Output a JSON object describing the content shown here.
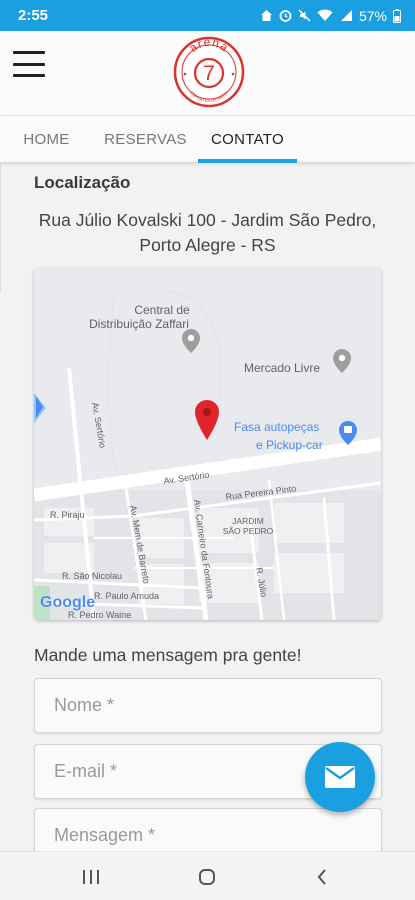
{
  "status_bar": {
    "time": "2:55",
    "battery": "57%",
    "icons": [
      "home-icon",
      "alarm-icon",
      "mute-icon",
      "wifi-icon",
      "signal-icon",
      "battery-icon"
    ]
  },
  "header": {
    "menu_icon": "hamburger-menu-icon",
    "logo": {
      "top_text": "arena",
      "number": "7",
      "bottom_text": "ESPORTES DE AREIA"
    }
  },
  "tabs": [
    {
      "label": "HOME",
      "active": false
    },
    {
      "label": "RESERVAS",
      "active": false
    },
    {
      "label": "CONTATO",
      "active": true
    }
  ],
  "location": {
    "title": "Localização",
    "address": "Rua Júlio Kovalski 100 - Jardim São Pedro, Porto Alegre - RS"
  },
  "map": {
    "labels": {
      "poi_zaffari_1": "Central de",
      "poi_zaffari_2": "Distribuição Zaffari",
      "poi_mercado": "Mercado Livre",
      "poi_fasa_1": "Fasa autopeças",
      "poi_fasa_2": "e Pickup-car",
      "street_sertorio_h": "Av. Sertório",
      "street_sertorio_v": "Av. Sertório",
      "street_pereira": "Rua Pereira Pinto",
      "district_1": "JARDIM",
      "district_2": "SÃO PEDRO",
      "street_piraju": "R. Piraju",
      "street_mem": "Av. Mem de Barreto",
      "street_carneiro": "Av. Carneiro da Fontoura",
      "street_nicolau": "R. São Nicolau",
      "street_amuda": "R. Paulo Amuda",
      "street_pedro": "R. Pedro Waine",
      "street_julio": "R. Júlio",
      "google": "Google"
    },
    "colors": {
      "water": "#8ec9ec",
      "poi": "#9e9e9e",
      "shopping": "#4a8af4",
      "pin": "#e0252b"
    }
  },
  "contact_form": {
    "title": "Mande uma mensagem pra gente!",
    "name_placeholder": "Nome *",
    "email_placeholder": "E-mail *",
    "message_placeholder": "Mensagem *",
    "fab_icon": "envelope-icon"
  },
  "nav": {
    "recents_icon": "recents-icon",
    "home_icon": "home-circle-icon",
    "back_icon": "back-chevron-icon"
  },
  "colors": {
    "primary": "#1a9fe0",
    "logo_red": "#d9342b"
  }
}
